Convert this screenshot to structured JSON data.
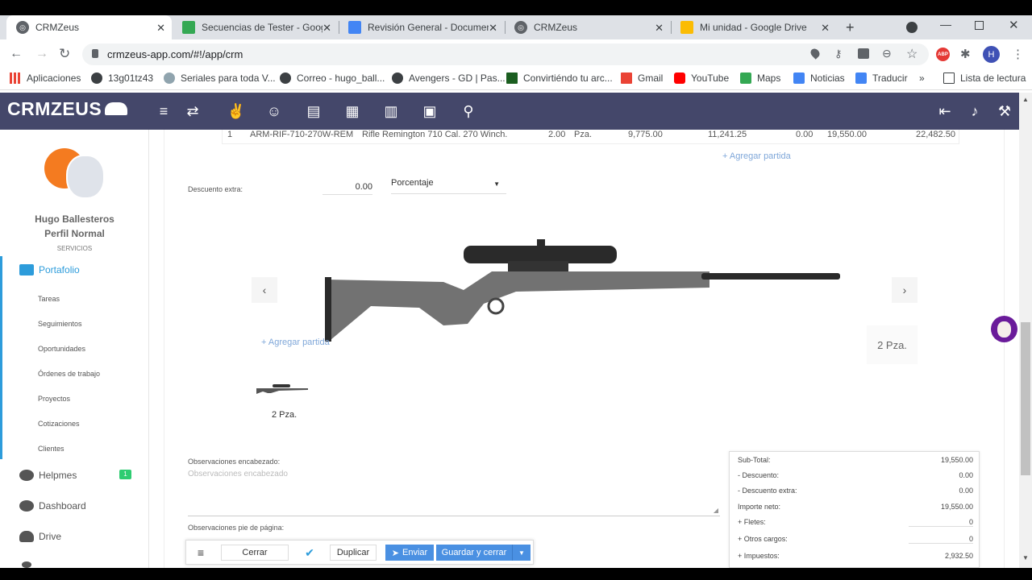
{
  "browser": {
    "tabs": [
      {
        "title": "CRMZeus",
        "active": true
      },
      {
        "title": "Secuencias de Tester - Google"
      },
      {
        "title": "Revisión General - Documento"
      },
      {
        "title": "CRMZeus"
      },
      {
        "title": "Mi unidad - Google Drive"
      }
    ],
    "url": "crmzeus-app.com/#!/app/crm",
    "bookmarks": [
      "Aplicaciones",
      "13g01tz43",
      "Seriales para toda V...",
      "Correo - hugo_ball...",
      "Avengers - GD | Pas...",
      "Convirtiéndo tu arc...",
      "Gmail",
      "YouTube",
      "Maps",
      "Noticias",
      "Traducir",
      "Lista de lectura"
    ],
    "profile_initial": "H",
    "abp": "ABP"
  },
  "app": {
    "logo": "CRMZEUS"
  },
  "sidebar": {
    "user_name": "Hugo Ballesteros",
    "profile": "Perfil Normal",
    "section": "SERVICIOS",
    "main_item": "Portafolio",
    "sub_items": [
      "Tareas",
      "Seguimientos",
      "Oportunidades",
      "Órdenes de trabajo",
      "Proyectos",
      "Cotizaciones",
      "Clientes"
    ],
    "bottom_items": [
      {
        "label": "Helpmes",
        "badge": "1"
      },
      {
        "label": "Dashboard"
      },
      {
        "label": "Drive"
      }
    ]
  },
  "table_row": {
    "num": "1",
    "code": "ARM-RIF-710-270W-REM",
    "description": "Rifle Remington 710 Cal. 270 Winch.",
    "qty": "2.00",
    "unit": "Pza.",
    "price": "9,775.00",
    "price_tax": "11,241.25",
    "discount": "0.00",
    "subtotal": "19,550.00",
    "total": "22,482.50"
  },
  "add_line": "+ Agregar partida",
  "discount": {
    "label": "Descuento extra:",
    "value": "0.00",
    "type": "Porcentaje"
  },
  "carousel": {
    "qty_label": "2 Pza.",
    "thumb_label": "2 Pza.",
    "overlay_link": "+ Agregar partida"
  },
  "notes": {
    "header_label": "Observaciones encabezado:",
    "header_placeholder": "Observaciones encabezado",
    "footer_label": "Observaciones pie de página:"
  },
  "totals": [
    {
      "label": "Sub-Total:",
      "value": "19,550.00"
    },
    {
      "label": "- Descuento:",
      "value": "0.00"
    },
    {
      "label": "- Descuento extra:",
      "value": "0.00"
    },
    {
      "label": "Importe neto:",
      "value": "19,550.00"
    },
    {
      "label": "+ Fletes:",
      "value": "0"
    },
    {
      "label": "+ Otros cargos:",
      "value": "0"
    },
    {
      "label": "+ Impuestos:",
      "value": "2,932.50"
    }
  ],
  "actions": {
    "close": "Cerrar",
    "duplicate": "Duplicar",
    "send": "Enviar",
    "save_close": "Guardar y cerrar"
  },
  "colors": {
    "header": "#44476a",
    "accent": "#2d9cdb",
    "button_blue": "#4a90e2"
  }
}
